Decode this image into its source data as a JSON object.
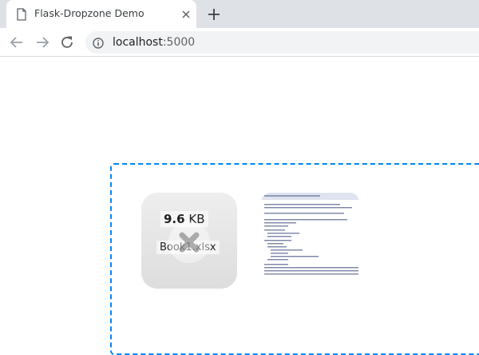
{
  "browser": {
    "tab_title": "Flask-Dropzone Demo",
    "url_host": "localhost",
    "url_port": ":5000"
  },
  "dropzone": {
    "file": {
      "size_number": "9.6",
      "size_unit": "KB",
      "name": "Book1.xlsx"
    }
  },
  "icons": {
    "favicon": "page-icon",
    "close_tab": "close-icon",
    "new_tab": "plus-icon",
    "back": "arrow-left-icon",
    "forward": "arrow-right-icon",
    "reload": "reload-icon",
    "site_info": "info-icon",
    "error_mark": "error-x-icon"
  }
}
